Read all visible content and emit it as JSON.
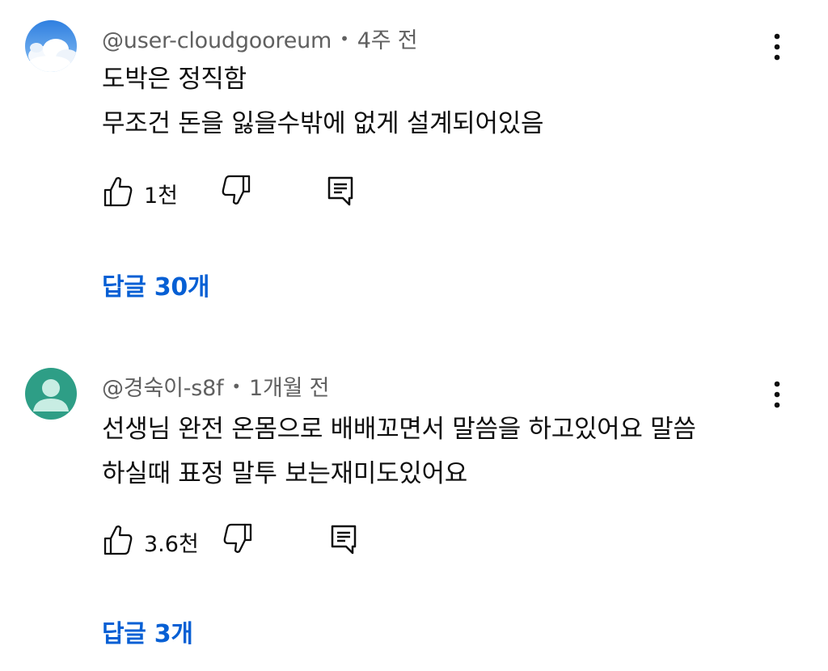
{
  "comments": [
    {
      "author": "@user-cloudgooreum",
      "separator": "•",
      "time": "4주 전",
      "lines": [
        "도박은 정직함",
        "무조건 돈을 잃을수밖에 없게 설계되어있음"
      ],
      "likes": "1천",
      "replies": "답글 30개",
      "avatar_icon": "sky-cloud-avatar"
    },
    {
      "author": "@경숙이-s8f",
      "separator": "•",
      "time": "1개월 전",
      "lines": [
        "선생님 완전 온몸으로 배배꼬면서 말씀을 하고있어요 말씀",
        "하실때 표정  말투  보는재미도있어요"
      ],
      "likes": "3.6천",
      "replies": "답글 3개",
      "avatar_icon": "default-person-avatar",
      "avatar_color": "#2e9e86"
    }
  ]
}
